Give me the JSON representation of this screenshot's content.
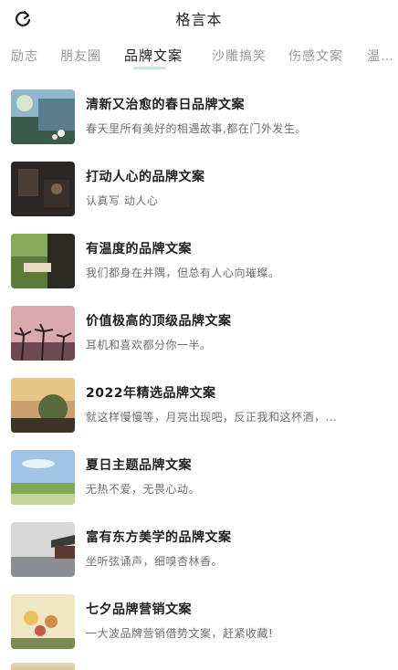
{
  "header": {
    "title": "格言本"
  },
  "tabs": [
    {
      "label": "励志"
    },
    {
      "label": "朋友圈"
    },
    {
      "label": "品牌文案"
    },
    {
      "label": "沙雕搞笑"
    },
    {
      "label": "伤感文案"
    },
    {
      "label": "温…"
    }
  ],
  "active_tab": "品牌文案",
  "items": [
    {
      "title": "清新又治愈的春日品牌文案",
      "subtitle": "春天里所有美好的相遇故事,都在门外发生。"
    },
    {
      "title": "打动人心的品牌文案",
      "subtitle": "认真写  动人心"
    },
    {
      "title": "有温度的品牌文案",
      "subtitle": "我们都身在井隅，但总有人心向璀璨。"
    },
    {
      "title": "价值极高的顶级品牌文案",
      "subtitle": "耳机和喜欢都分你一半。"
    },
    {
      "title": "2022年精选品牌文案",
      "subtitle": "就这样慢慢等，月亮出现吧，反正我和这杯酒，..."
    },
    {
      "title": "夏日主题品牌文案",
      "subtitle": "无热不爱，无畏心动。"
    },
    {
      "title": "富有东方美学的品牌文案",
      "subtitle": "坐听弦诵声，细嗅杏林香。"
    },
    {
      "title": "七夕品牌营销文案",
      "subtitle": "一大波品牌营销借势文案，赶紧收藏!"
    }
  ],
  "colors": {
    "accent_underline": "#c9e6d9",
    "text_primary": "#1e1e1e",
    "text_secondary": "#6f6f6f",
    "tab_inactive": "#9a9a9a"
  }
}
